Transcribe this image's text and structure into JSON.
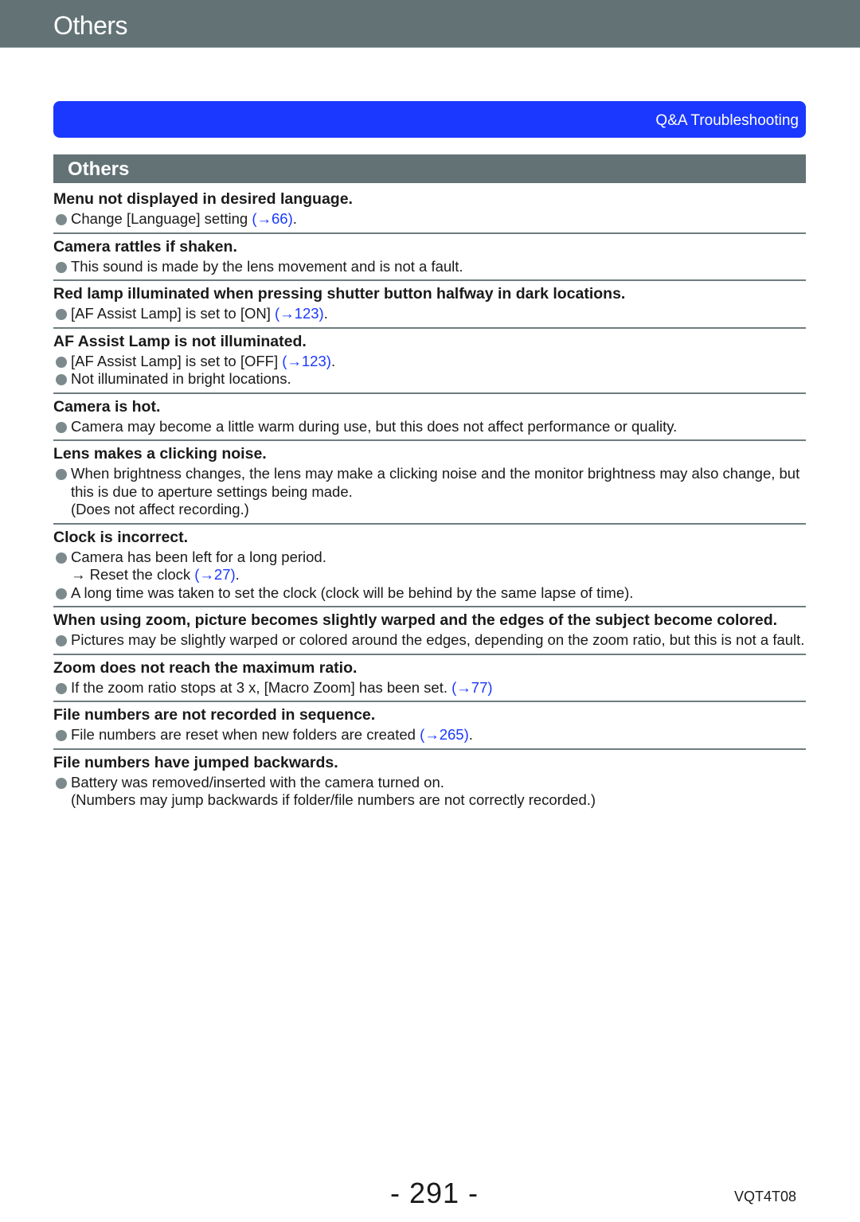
{
  "header": {
    "title": "Others"
  },
  "qa_bar": {
    "label": "Q&A  Troubleshooting"
  },
  "section": {
    "title": "Others"
  },
  "items": [
    {
      "question": "Menu not displayed in desired language.",
      "answers": [
        {
          "bullet": true,
          "text": "Change [Language] setting ",
          "ref": "(→66)",
          "after": "."
        }
      ]
    },
    {
      "question": "Camera rattles if shaken.",
      "answers": [
        {
          "bullet": true,
          "text": "This sound is made by the lens movement and is not a fault.",
          "ref": "",
          "after": ""
        }
      ]
    },
    {
      "question": "Red lamp illuminated when pressing shutter button halfway in dark locations.",
      "answers": [
        {
          "bullet": true,
          "text": "[AF Assist Lamp] is set to [ON] ",
          "ref": "(→123)",
          "after": "."
        }
      ]
    },
    {
      "question": "AF Assist Lamp is not illuminated.",
      "answers": [
        {
          "bullet": true,
          "text": "[AF Assist Lamp] is set to [OFF] ",
          "ref": "(→123)",
          "after": "."
        },
        {
          "bullet": true,
          "text": "Not illuminated in bright locations.",
          "ref": "",
          "after": ""
        }
      ]
    },
    {
      "question": "Camera is hot.",
      "answers": [
        {
          "bullet": true,
          "text": "Camera may become a little warm during use, but this does not affect performance or quality.",
          "ref": "",
          "after": ""
        }
      ]
    },
    {
      "question": "Lens makes a clicking noise.",
      "answers": [
        {
          "bullet": true,
          "text": "When brightness changes, the lens may make a clicking noise and the monitor brightness may also change, but this is due to aperture settings being made.",
          "ref": "",
          "after": ""
        },
        {
          "bullet": false,
          "text": "(Does not affect recording.)",
          "ref": "",
          "after": ""
        }
      ]
    },
    {
      "question": "Clock is incorrect.",
      "answers": [
        {
          "bullet": true,
          "text": "Camera has been left for a long period.",
          "ref": "",
          "after": ""
        },
        {
          "bullet": false,
          "text": "→ Reset the clock ",
          "ref": "(→27)",
          "after": "."
        },
        {
          "bullet": true,
          "text": "A long time was taken to set the clock (clock will be behind by the same lapse of time).",
          "ref": "",
          "after": ""
        }
      ]
    },
    {
      "question": "When using zoom, picture becomes slightly warped and the edges of the subject become colored.",
      "answers": [
        {
          "bullet": true,
          "text": "Pictures may be slightly warped or colored around the edges, depending on the zoom ratio, but this is not a fault.",
          "ref": "",
          "after": ""
        }
      ]
    },
    {
      "question": "Zoom does not reach the maximum ratio.",
      "answers": [
        {
          "bullet": true,
          "text": "If the zoom ratio stops at 3 x, [Macro Zoom] has been set. ",
          "ref": "(→77)",
          "after": ""
        }
      ]
    },
    {
      "question": "File numbers are not recorded in sequence.",
      "answers": [
        {
          "bullet": true,
          "text": "File numbers are reset when new folders are created ",
          "ref": "(→265)",
          "after": "."
        }
      ]
    },
    {
      "question": "File numbers have jumped backwards.",
      "answers": [
        {
          "bullet": true,
          "text": "Battery was removed/inserted with the camera turned on.",
          "ref": "",
          "after": ""
        },
        {
          "bullet": false,
          "text": "(Numbers may jump backwards if folder/file numbers are not correctly recorded.)",
          "ref": "",
          "after": ""
        }
      ]
    }
  ],
  "footer": {
    "page_number": "- 291 -",
    "doc_code": "VQT4T08"
  },
  "colors": {
    "banner": "#627275",
    "qa_bar": "#1a38ff",
    "link": "#1a38ff",
    "bullet": "#7c8a8d"
  }
}
